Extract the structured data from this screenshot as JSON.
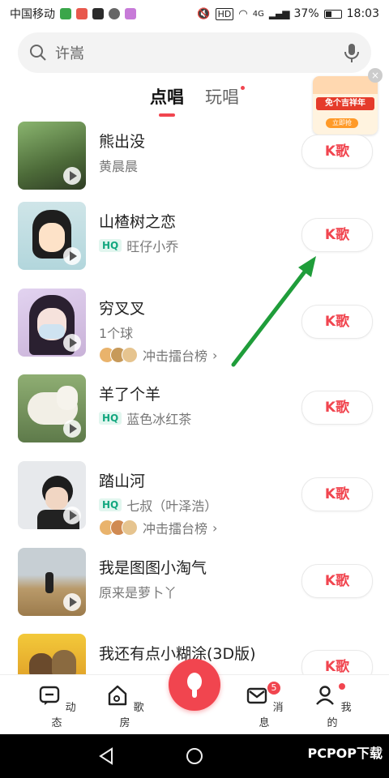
{
  "status_bar": {
    "carrier": "中国移动",
    "network": "HD",
    "signal": "4G",
    "battery": "37%",
    "time": "18:03"
  },
  "search": {
    "placeholder": "许嵩",
    "icon_left": "search-icon",
    "icon_right": "microphone-icon"
  },
  "tabs": [
    {
      "label": "点唱",
      "active": true
    },
    {
      "label": "玩唱",
      "active": false,
      "has_dot": true
    }
  ],
  "promo": {
    "title": "免个吉祥年",
    "button": "立即抢",
    "close": "×"
  },
  "songs": [
    {
      "title": "熊出没",
      "artist": "黄晨晨",
      "hq": false,
      "rank": null,
      "button": "K歌"
    },
    {
      "title": "山楂树之恋",
      "artist": "旺仔小乔",
      "hq": true,
      "rank": null,
      "button": "K歌"
    },
    {
      "title": "穷叉叉",
      "artist": "1个球",
      "hq": false,
      "rank": "冲击擂台榜",
      "button": "K歌"
    },
    {
      "title": "羊了个羊",
      "artist": "蓝色冰红茶",
      "hq": true,
      "rank": null,
      "button": "K歌"
    },
    {
      "title": "踏山河",
      "artist": "七叔（叶泽浩）",
      "hq": true,
      "rank": "冲击擂台榜",
      "button": "K歌"
    },
    {
      "title": "我是图图小淘气",
      "artist": "原来是萝卜丫",
      "hq": false,
      "rank": null,
      "button": "K歌"
    },
    {
      "title": "我还有点小糊涂(3D版)",
      "artist": "",
      "hq": false,
      "rank": null,
      "button": "K歌"
    }
  ],
  "hq_label": "HQ",
  "rank_chevron": "›",
  "bottom_nav": [
    {
      "label": "动态",
      "icon": "chat-icon"
    },
    {
      "label": "歌房",
      "icon": "home-music-icon"
    },
    {
      "label": "",
      "icon": "mic-center-icon"
    },
    {
      "label": "消息",
      "icon": "mail-icon",
      "badge": "5"
    },
    {
      "label": "我的",
      "icon": "person-icon",
      "has_dot": true
    }
  ],
  "watermark": "PCPOP下载",
  "colors": {
    "accent": "#f1454f",
    "hq": "#13a77f",
    "arrow": "#1f9d3a"
  }
}
